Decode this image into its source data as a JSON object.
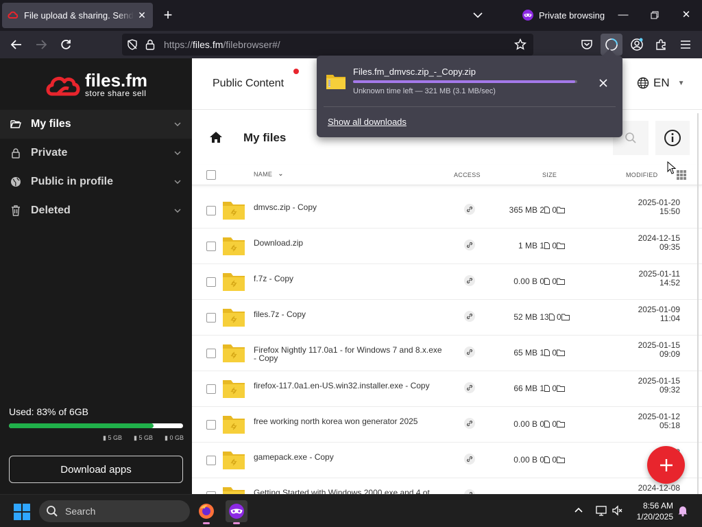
{
  "browser": {
    "tab_title": "File upload & sharing. Send large files",
    "private_label": "Private browsing",
    "url_host": "https://files.fm",
    "url_path": "/filebrowser#/"
  },
  "download": {
    "filename": "Files.fm_dmvsc.zip_-_Copy.zip",
    "status": "Unknown time left — 321 MB (3.1 MB/sec)",
    "progress": 0.99,
    "show_all_label": "Show all downloads"
  },
  "site": {
    "logo_name": "files.fm",
    "logo_tagline": "store share sell",
    "public_content_label": "Public Content",
    "language": "EN",
    "page_title": "My files",
    "colors": {
      "brand_red": "#e8252d",
      "usage_green": "#20b04a"
    }
  },
  "sidebar": {
    "items": [
      {
        "label": "My files",
        "icon": "folder-open-icon"
      },
      {
        "label": "Private",
        "icon": "lock-icon"
      },
      {
        "label": "Public in profile",
        "icon": "globe-icon"
      },
      {
        "label": "Deleted",
        "icon": "trash-icon"
      }
    ],
    "usage_label": "Used: 83% of 6GB",
    "usage_fraction": 0.83,
    "usage_legend": [
      "5 GB",
      "5 GB",
      "0 GB"
    ],
    "download_apps_label": "Download apps"
  },
  "table": {
    "headers": {
      "name": "NAME",
      "access": "ACCESS",
      "size": "SIZE",
      "modified": "MODIFIED"
    },
    "rows": [
      {
        "name": "dmvsc.zip - Copy",
        "size": "365 MB",
        "files": "2",
        "folders": "0",
        "date": "2025-01-20",
        "time": "15:50"
      },
      {
        "name": "Download.zip",
        "size": "1 MB",
        "files": "1",
        "folders": "0",
        "date": "2024-12-15",
        "time": "09:35"
      },
      {
        "name": "f.7z - Copy",
        "size": "0.00  B",
        "files": "0",
        "folders": "0",
        "date": "2025-01-11",
        "time": "14:52"
      },
      {
        "name": "files.7z - Copy",
        "size": "52 MB",
        "files": "13",
        "folders": "0",
        "date": "2025-01-09",
        "time": "11:04"
      },
      {
        "name": "Firefox Nightly 117.0a1 - for Windows 7 and 8.x.exe - Copy",
        "size": "65 MB",
        "files": "1",
        "folders": "0",
        "date": "2025-01-15",
        "time": "09:09"
      },
      {
        "name": "firefox-117.0a1.en-US.win32.installer.exe - Copy",
        "size": "66 MB",
        "files": "1",
        "folders": "0",
        "date": "2025-01-15",
        "time": "09:32"
      },
      {
        "name": "free working north korea won generator 2025",
        "size": "0.00  B",
        "files": "0",
        "folders": "0",
        "date": "2025-01-12",
        "time": "05:18"
      },
      {
        "name": "gamepack.exe - Copy",
        "size": "0.00  B",
        "files": "0",
        "folders": "0",
        "date": "202",
        "time": ""
      },
      {
        "name": "Getting Started with Windows 2000.exe and 4 ot",
        "size": "",
        "files": "",
        "folders": "",
        "date": "2024-12-08",
        "time": ""
      }
    ]
  },
  "taskbar": {
    "search_placeholder": "Search",
    "time": "8:56 AM",
    "date": "1/20/2025"
  }
}
